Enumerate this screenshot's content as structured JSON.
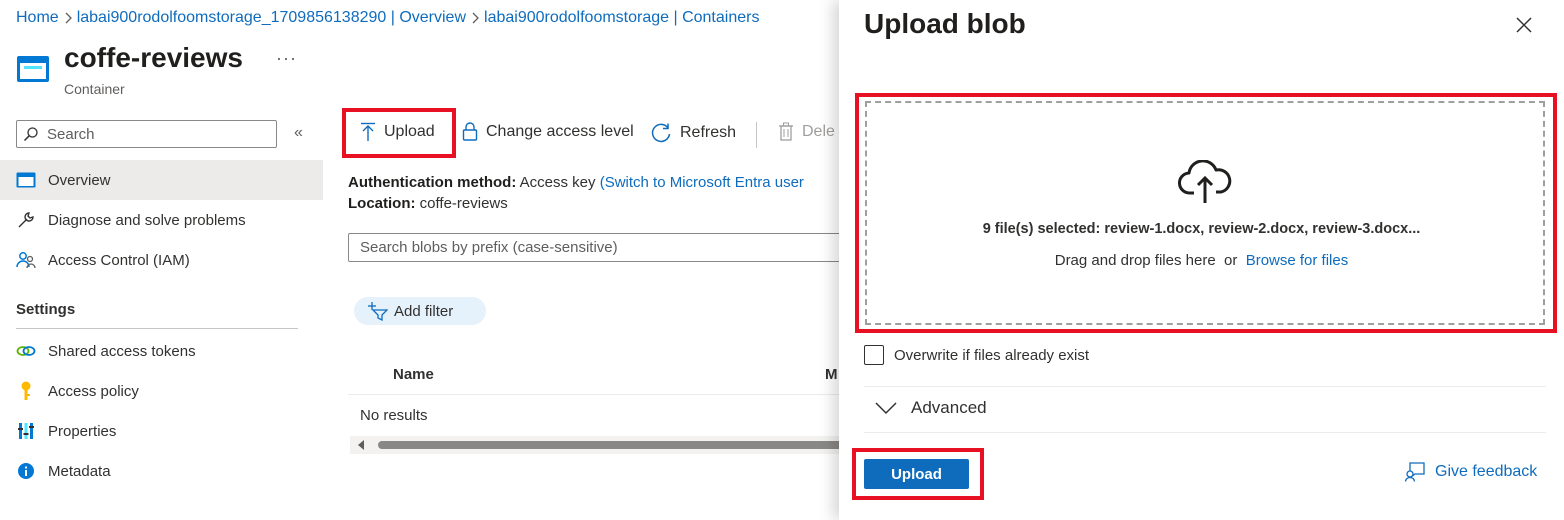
{
  "breadcrumb": {
    "home": "Home",
    "storage_overview": "labai900rodolfoomstorage_1709856138290 | Overview",
    "containers": "labai900rodolfoomstorage | Containers"
  },
  "header": {
    "title": "coffe-reviews",
    "subtitle": "Container",
    "more": "···"
  },
  "sidebar": {
    "search_placeholder": "Search",
    "collapse": "«",
    "items": [
      {
        "label": "Overview",
        "icon": "container-icon"
      },
      {
        "label": "Diagnose and solve problems",
        "icon": "wrench-icon"
      },
      {
        "label": "Access Control (IAM)",
        "icon": "people-icon"
      }
    ],
    "settings_header": "Settings",
    "settings_items": [
      {
        "label": "Shared access tokens",
        "icon": "link-icon"
      },
      {
        "label": "Access policy",
        "icon": "key-icon"
      },
      {
        "label": "Properties",
        "icon": "bars-icon"
      },
      {
        "label": "Metadata",
        "icon": "info-icon"
      }
    ]
  },
  "toolbar": {
    "upload": "Upload",
    "change_access": "Change access level",
    "refresh": "Refresh",
    "delete": "Dele"
  },
  "info": {
    "auth_label": "Authentication method:",
    "auth_value": "Access key",
    "auth_link": "(Switch to Microsoft Entra user",
    "location_label": "Location:",
    "location_value": "coffe-reviews"
  },
  "blob_search": {
    "placeholder": "Search blobs by prefix (case-sensitive)"
  },
  "filter": {
    "label": "Add filter"
  },
  "table": {
    "columns": [
      "Name",
      "M"
    ],
    "empty": "No results"
  },
  "panel": {
    "title": "Upload blob",
    "selected": "9 file(s) selected: review-1.docx, review-2.docx, review-3.docx...",
    "drag_text": "Drag and drop files here",
    "or": "or",
    "browse": "Browse for files",
    "overwrite": "Overwrite if files already exist",
    "advanced": "Advanced",
    "upload_button": "Upload",
    "feedback": "Give feedback"
  },
  "colors": {
    "accent": "#0f6cbd",
    "highlight": "#e81123",
    "selected_bg": "#edebe9"
  }
}
